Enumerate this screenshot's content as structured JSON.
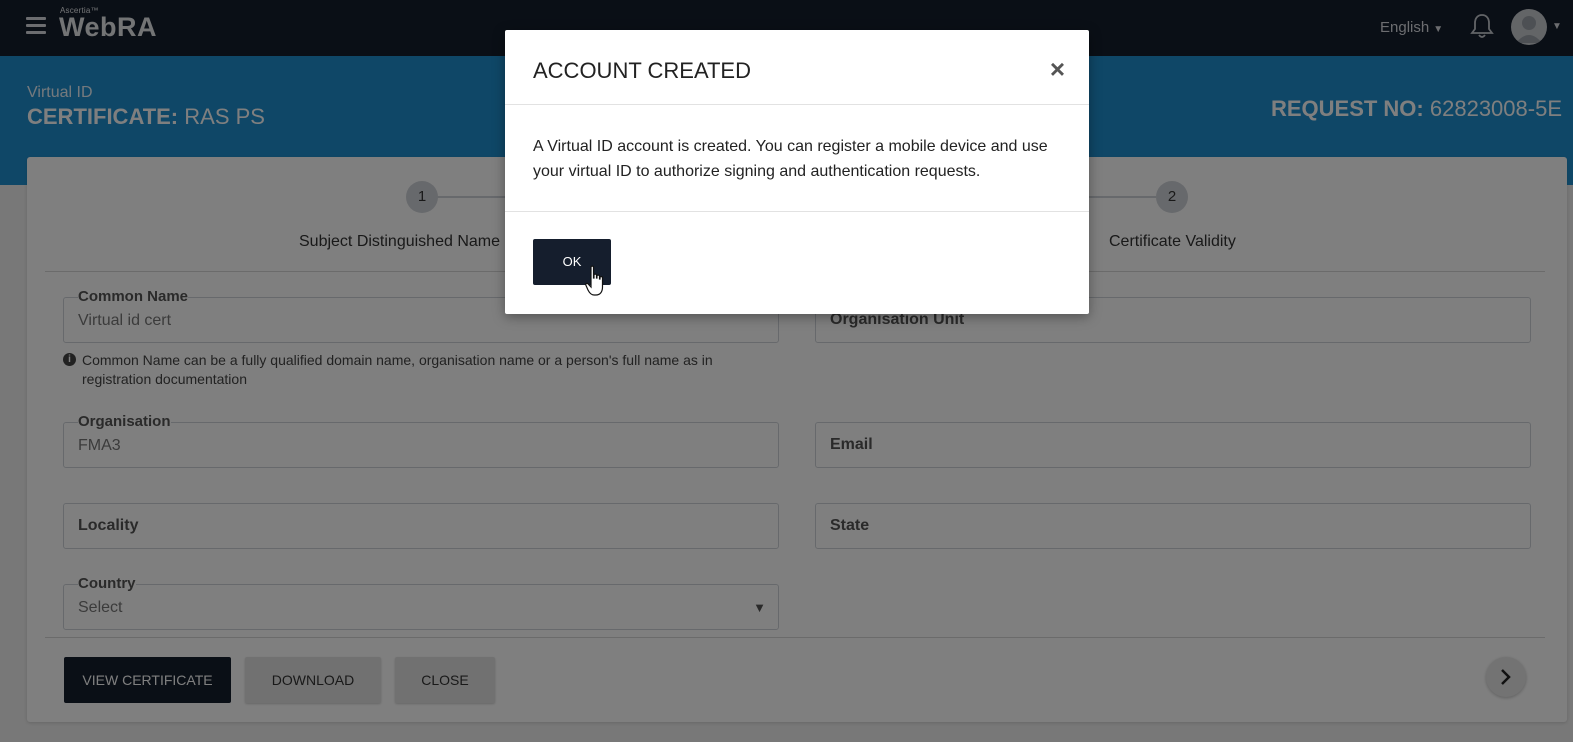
{
  "topbar": {
    "logo_small": "Ascertia™",
    "logo_main": "WebRA",
    "language": "English",
    "icons": {
      "menu": "hamburger-menu-icon",
      "notifications": "bell-icon",
      "user": "user-avatar-icon"
    }
  },
  "header": {
    "subtitle": "Virtual ID",
    "cert_label": "CERTIFICATE:",
    "cert_value": "RAS PS",
    "request_label": "REQUEST NO:",
    "request_value": "62823008-5E"
  },
  "steps": [
    {
      "number": "1",
      "label": "Subject Distinguished Name"
    },
    {
      "number": "2",
      "label": "Certificate Validity"
    }
  ],
  "form": {
    "common_name": {
      "label": "Common Name",
      "value": "Virtual id cert"
    },
    "common_name_hint": "Common Name can be a fully qualified domain name, organisation name or a person's full name as in registration documentation",
    "organisation_unit": {
      "placeholder": "Organisation Unit"
    },
    "organisation": {
      "label": "Organisation",
      "value": "FMA3"
    },
    "email": {
      "placeholder": "Email"
    },
    "locality": {
      "placeholder": "Locality"
    },
    "state": {
      "placeholder": "State"
    },
    "country": {
      "label": "Country",
      "value": "Select"
    }
  },
  "actions": {
    "view_certificate": "VIEW CERTIFICATE",
    "download": "DOWNLOAD",
    "close": "CLOSE"
  },
  "modal": {
    "title": "ACCOUNT CREATED",
    "body": "A Virtual ID account is created. You can register a mobile device and use your virtual ID to authorize signing and authentication requests.",
    "ok_label": "OK",
    "close_glyph": "×"
  },
  "colors": {
    "topbar": "#151e2d",
    "header_blue": "#1f8fcf",
    "primary_button": "#151e2d"
  }
}
